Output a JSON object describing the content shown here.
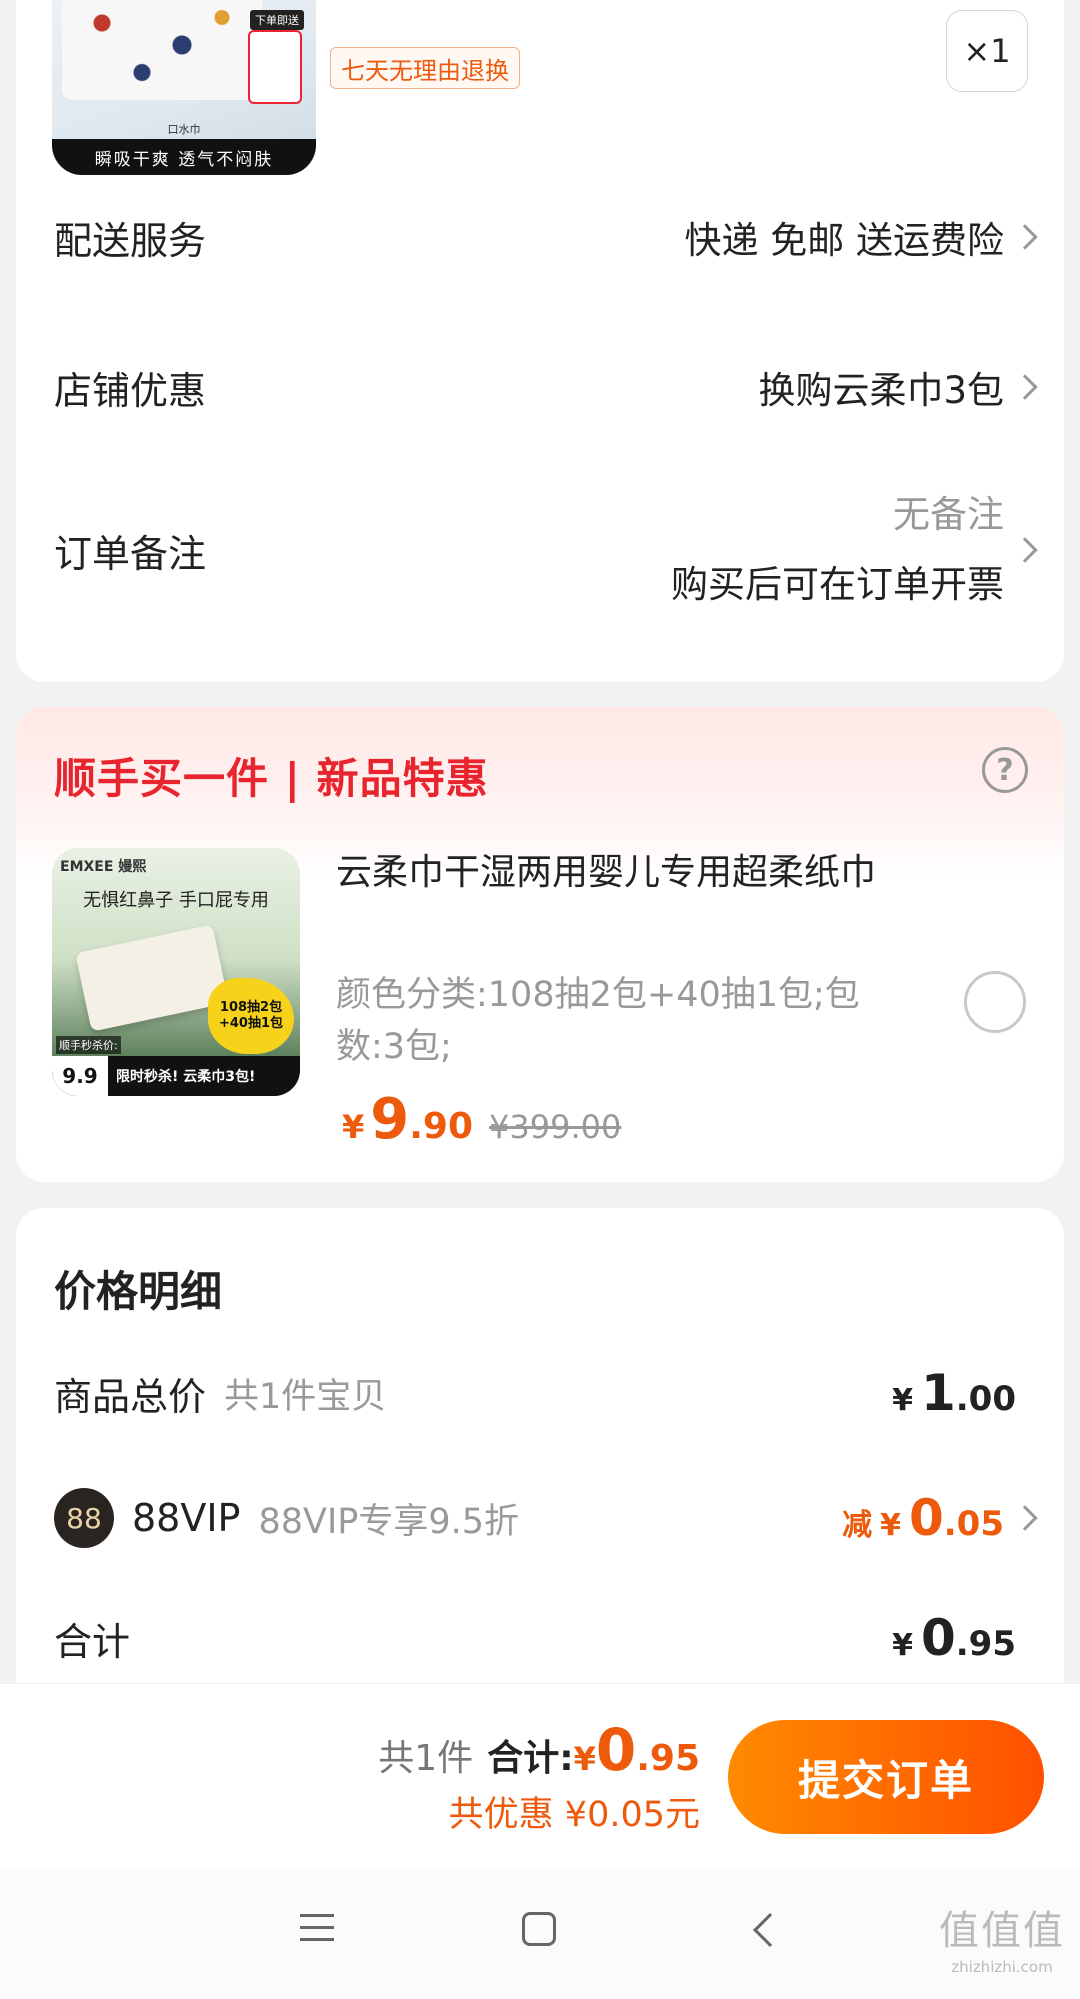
{
  "product": {
    "thumb_strip_text": "瞬吸干爽 透气不闷肤",
    "thumb_small_label": "口水巾",
    "thumb_tag": "下单即送",
    "return_badge": "七天无理由退换",
    "quantity": "×1"
  },
  "order_rows": {
    "shipping": {
      "label": "配送服务",
      "value": "快递 免邮 送运费险"
    },
    "shop_discount": {
      "label": "店铺优惠",
      "value": "换购云柔巾3包"
    },
    "note": {
      "label": "订单备注",
      "value_line1": "无备注",
      "value_line2": "购买后可在订单开票"
    }
  },
  "upsell": {
    "title": "顺手买一件 | 新品特惠",
    "help_icon": "question-circle-icon",
    "thumb": {
      "brand": "EMXEE 嫚熙",
      "headline": "无惧红鼻子 手口屁专用",
      "burst": "108抽2包 +40抽1包",
      "flash_label": "顺手秒杀价:",
      "price": "9.9",
      "bar_text": "限时秒杀! 云柔巾3包!"
    },
    "name": "云柔巾干湿两用婴儿专用超柔纸巾",
    "spec": "颜色分类:108抽2包+40抽1包;包数:3包;",
    "price": {
      "currency": "¥",
      "int": "9",
      "dec": ".90"
    },
    "original_price": "¥399.00",
    "selected": false
  },
  "price_detail": {
    "title": "价格明细",
    "goods_total": {
      "label": "商品总价",
      "sub": "共1件宝贝",
      "currency": "¥",
      "int": "1",
      "dec": ".00"
    },
    "vip": {
      "icon_text": "88",
      "label": "88VIP",
      "sub": "88VIP专享9.5折",
      "prefix": "减",
      "currency": "¥",
      "int": "0",
      "dec": ".05"
    },
    "total": {
      "label": "合计",
      "currency": "¥",
      "int": "0",
      "dec": ".95"
    }
  },
  "bottom_bar": {
    "count": "共1件",
    "sum_label": "合计:",
    "currency": "¥",
    "sum_int": "0",
    "sum_dec": ".95",
    "discount_text": "共优惠 ¥0.05元",
    "submit_label": "提交订单"
  },
  "watermark": {
    "big": "值值值",
    "small": "zhizhizhi.com"
  },
  "colors": {
    "accent": "#ee5a0c",
    "upsell_red": "#e8242e",
    "button_start": "#ff8a00",
    "button_end": "#ff5000"
  }
}
